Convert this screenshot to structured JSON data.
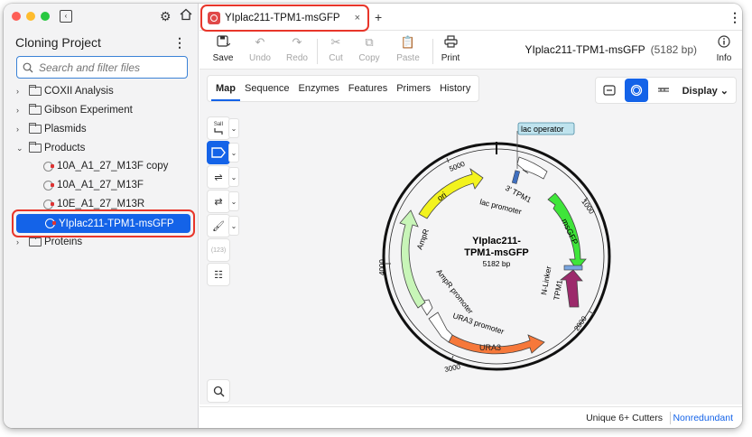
{
  "sidebar": {
    "project_title": "Cloning Project",
    "search_placeholder": "Search and filter files",
    "folders": [
      {
        "label": "COXII Analysis"
      },
      {
        "label": "Gibson Experiment"
      },
      {
        "label": "Plasmids"
      },
      {
        "label": "Products"
      }
    ],
    "products_children": [
      {
        "label": "10A_A1_27_M13F copy"
      },
      {
        "label": "10A_A1_27_M13F"
      },
      {
        "label": "10E_A1_27_M13R"
      },
      {
        "label": "YIplac211-TPM1-msGFP"
      }
    ],
    "proteins_label": "Proteins"
  },
  "tab": {
    "label": "YIplac211-TPM1-msGFP",
    "close": "×",
    "add": "+"
  },
  "toolbar": {
    "save": "Save",
    "undo": "Undo",
    "redo": "Redo",
    "cut": "Cut",
    "copy": "Copy",
    "paste": "Paste",
    "print": "Print",
    "info": "Info",
    "seq_name": "YIplac211-TPM1-msGFP",
    "seq_length": "(5182 bp)"
  },
  "view_tabs": [
    "Map",
    "Sequence",
    "Enzymes",
    "Features",
    "Primers",
    "History"
  ],
  "display": {
    "label": "Display"
  },
  "tools": {
    "enzyme_label": "SalI",
    "counter": "(123)"
  },
  "map": {
    "name_line1": "YIplac211-",
    "name_line2": "TPM1-msGFP",
    "length": "5182 bp",
    "ticks": [
      "1000",
      "2000",
      "3000",
      "4000",
      "5000"
    ],
    "features": [
      {
        "label": "ori",
        "color": "#f3f31e"
      },
      {
        "label": "msGFP",
        "color": "#3fe53a"
      },
      {
        "label": "TPM1",
        "color": "#9c2a6b"
      },
      {
        "label": "URA3",
        "color": "#f6783a"
      },
      {
        "label": "AmpR",
        "color": "#c8f5b8"
      },
      {
        "label": "3' TPM1",
        "color": "#ffffff"
      },
      {
        "label": "lac promoter",
        "color": "#ffffff"
      },
      {
        "label": "AmpR promoter",
        "color": "#ffffff"
      },
      {
        "label": "URA3 promoter",
        "color": "#ffffff"
      },
      {
        "label": "N-Linker",
        "color": "#ffffff"
      },
      {
        "label": "lac operator",
        "color": "#bfe3ee"
      }
    ]
  },
  "status": {
    "cutters": "Unique 6+ Cutters",
    "mode": "Nonredundant"
  }
}
